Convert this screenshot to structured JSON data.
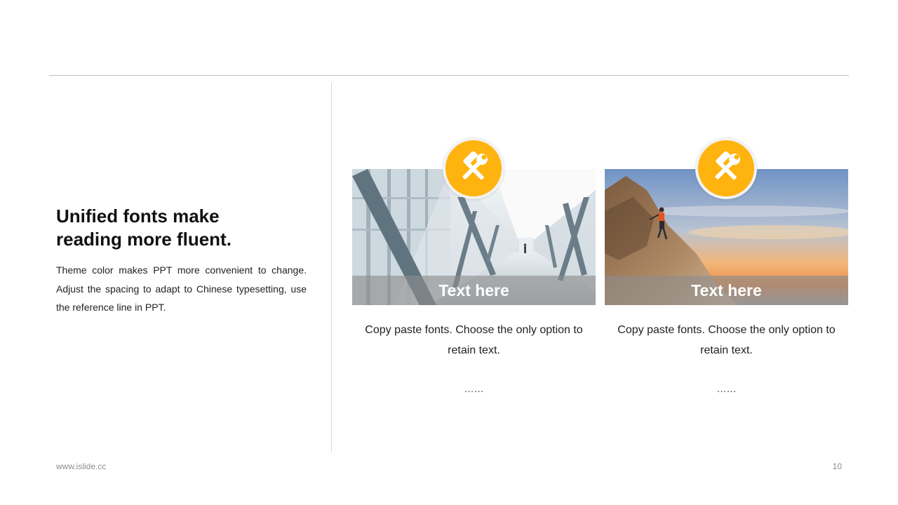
{
  "left": {
    "heading": "Unified fonts make reading more fluent.",
    "body": "Theme color makes PPT more convenient to change. Adjust the spacing to adapt to Chinese typesetting, use the reference line in PPT."
  },
  "cards": [
    {
      "caption": "Text here",
      "description": "Copy paste fonts. Choose the only option to retain text.",
      "ellipsis": "……",
      "icon": "tools-icon"
    },
    {
      "caption": "Text here",
      "description": "Copy paste fonts. Choose the only option to retain text.",
      "ellipsis": "……",
      "icon": "tools-icon"
    }
  ],
  "footer": {
    "url": "www.islide.cc",
    "page_number": "10"
  },
  "colors": {
    "accent": "#ffb30f",
    "rule": "#bfbfbf",
    "text": "#222222"
  }
}
